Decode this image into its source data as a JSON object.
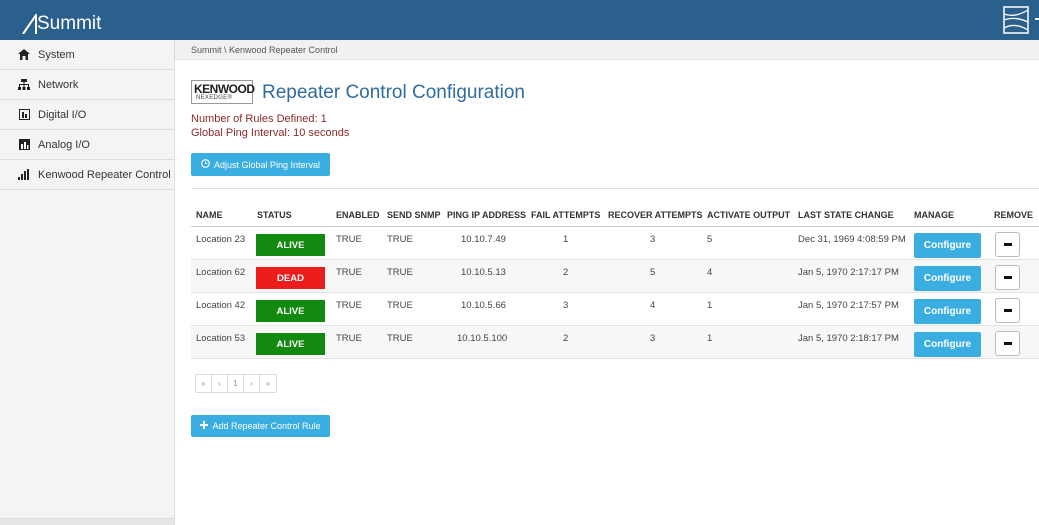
{
  "app": {
    "brand": "Summit"
  },
  "sidebar": {
    "items": [
      {
        "label": "System",
        "icon": "home-icon"
      },
      {
        "label": "Network",
        "icon": "network-icon"
      },
      {
        "label": "Digital I/O",
        "icon": "digital-io-icon"
      },
      {
        "label": "Analog I/O",
        "icon": "analog-io-icon"
      },
      {
        "label": "Kenwood Repeater Control",
        "icon": "signal-bars-icon"
      }
    ]
  },
  "breadcrumb": "Summit \\ Kenwood Repeater Control",
  "logo": {
    "brand": "KENWOOD",
    "sub": "NEXEDGE®"
  },
  "page": {
    "title": "Repeater Control Configuration",
    "rules_defined": "Number of Rules Defined: 1",
    "ping_interval": "Global Ping Interval: 10 seconds",
    "adjust_button": "Adjust Global Ping Interval",
    "add_button": "Add Repeater Control Rule"
  },
  "table": {
    "headers": [
      "NAME",
      "STATUS",
      "ENABLED",
      "SEND SNMP",
      "PING IP ADDRESS",
      "FAIL ATTEMPTS",
      "RECOVER ATTEMPTS",
      "ACTIVATE OUTPUT",
      "LAST STATE CHANGE",
      "MANAGE",
      "REMOVE"
    ],
    "configure_label": "Configure",
    "rows": [
      {
        "name": "Location 23",
        "status": "ALIVE",
        "enabled": "TRUE",
        "snmp": "TRUE",
        "ip": "10.10.7.49",
        "fail": "1",
        "recover": "3",
        "output": "5",
        "last": "Dec 31, 1969 4:08:59 PM"
      },
      {
        "name": "Location 62",
        "status": "DEAD",
        "enabled": "TRUE",
        "snmp": "TRUE",
        "ip": "10.10.5.13",
        "fail": "2",
        "recover": "5",
        "output": "4",
        "last": "Jan 5, 1970 2:17:17 PM"
      },
      {
        "name": "Location 42",
        "status": "ALIVE",
        "enabled": "TRUE",
        "snmp": "TRUE",
        "ip": "10.10.5.66",
        "fail": "3",
        "recover": "4",
        "output": "1",
        "last": "Jan 5, 1970 2:17:57 PM"
      },
      {
        "name": "Location 53",
        "status": "ALIVE",
        "enabled": "TRUE",
        "snmp": "TRUE",
        "ip": "10.10.5.100",
        "fail": "2",
        "recover": "3",
        "output": "1",
        "last": "Jan 5, 1970 2:18:17 PM"
      }
    ]
  },
  "pagination": {
    "first": "«",
    "prev": "‹",
    "page": "1",
    "next": "›",
    "last": "»"
  },
  "colors": {
    "topbar": "#2b5f8c",
    "accent": "#3aaee0",
    "alive": "#118a0f",
    "dead": "#ea1c1c",
    "info_text": "#8b2a2a",
    "title": "#2f6c9f"
  }
}
